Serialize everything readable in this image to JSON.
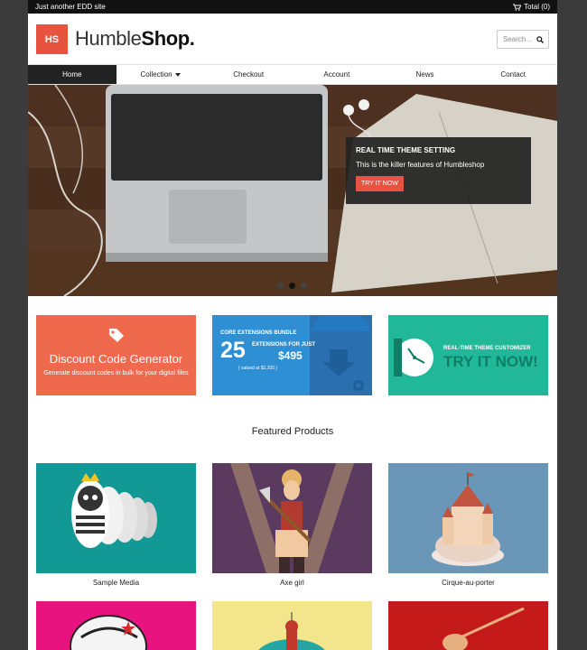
{
  "topbar": {
    "tagline": "Just another EDD site",
    "cart_label": "Total (0)"
  },
  "header": {
    "logo_initials": "HS",
    "logo_light": "Humble",
    "logo_bold": "Shop.",
    "search_placeholder": "Search .."
  },
  "nav": {
    "items": [
      {
        "label": "Home"
      },
      {
        "label": "Collection"
      },
      {
        "label": "Checkout"
      },
      {
        "label": "Account"
      },
      {
        "label": "News"
      },
      {
        "label": "Contact"
      }
    ]
  },
  "hero": {
    "caption_title": "REAL TIME THEME SETTING",
    "caption_text": "This is the killer features of Humbleshop",
    "caption_button": "TRY IT NOW"
  },
  "banners": {
    "discount_title": "Discount Code Generator",
    "discount_subtitle": "Generate discount codes in bulk for your digital files",
    "bundle_heading": "CORE EXTENSIONS BUNDLE",
    "bundle_number": "25",
    "bundle_extensions": "EXTENSIONS FOR JUST",
    "bundle_price": "$495",
    "bundle_value": "( valued at $2,200 )",
    "customizer_heading": "REAL-TIME THEME CUSTOMIZER",
    "customizer_cta": "TRY IT NOW!"
  },
  "featured_heading": "Featured Products",
  "products": [
    {
      "name": "Sample Media"
    },
    {
      "name": "Axe girl"
    },
    {
      "name": "Cirque-au-porter"
    }
  ],
  "colors": {
    "accent": "#e8533f",
    "nav_active": "#222222",
    "banner_discount": "#ef6a4c",
    "banner_bundle": "#2f8fd5",
    "banner_customizer": "#21b899"
  }
}
